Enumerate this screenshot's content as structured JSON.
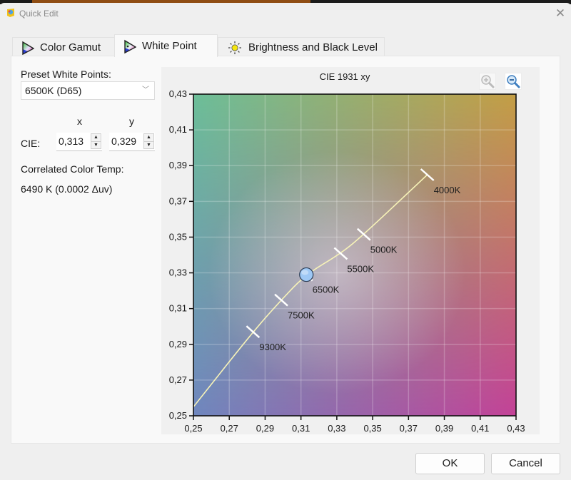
{
  "window": {
    "title": "Quick Edit",
    "close_icon": "close-icon"
  },
  "tabs": [
    {
      "label": "Color Gamut",
      "icon": "color-gamut-triangle-icon",
      "active": false
    },
    {
      "label": "White Point",
      "icon": "white-point-triangle-icon",
      "active": true
    },
    {
      "label": "Brightness and Black Level",
      "icon": "sun-icon",
      "active": false
    }
  ],
  "left": {
    "preset_label": "Preset White Points:",
    "preset_value": "6500K (D65)",
    "x_header": "x",
    "y_header": "y",
    "cie_label": "CIE:",
    "cie_x": "0,313",
    "cie_y": "0,329",
    "cct_label": "Correlated Color Temp:",
    "cct_value": "6490 K (0.0002 Δuv)"
  },
  "toolbar": {
    "zoom_in_icon": "zoom-in-icon",
    "zoom_out_icon": "zoom-out-icon"
  },
  "buttons": {
    "ok": "OK",
    "cancel": "Cancel"
  },
  "colors": {
    "corner_top_left": "#6cc396",
    "corner_top_right": "#c4a63e",
    "corner_bottom_left": "#6f83c0",
    "corner_bottom_right": "#c33c9c",
    "locus_line": "#f7f3b8",
    "point_fill": "#9ec8f5"
  },
  "chart_data": {
    "type": "scatter",
    "title": "CIE 1931 xy",
    "xlabel": "",
    "ylabel": "",
    "xlim": [
      0.25,
      0.43
    ],
    "ylim": [
      0.25,
      0.43
    ],
    "grid": true,
    "x_ticks": [
      "0,25",
      "0,27",
      "0,29",
      "0,31",
      "0,33",
      "0,35",
      "0,37",
      "0,39",
      "0,41",
      "0,43"
    ],
    "y_ticks": [
      "0,25",
      "0,27",
      "0,29",
      "0,31",
      "0,33",
      "0,35",
      "0,37",
      "0,39",
      "0,41",
      "0,43"
    ],
    "planckian_locus": [
      {
        "x": 0.25,
        "y": 0.255
      },
      {
        "x": 0.2832,
        "y": 0.297
      },
      {
        "x": 0.299,
        "y": 0.3148
      },
      {
        "x": 0.3128,
        "y": 0.3292
      },
      {
        "x": 0.3322,
        "y": 0.3408
      },
      {
        "x": 0.3451,
        "y": 0.3515
      },
      {
        "x": 0.3805,
        "y": 0.3849
      }
    ],
    "cct_marks": [
      {
        "label": "9300K",
        "x": 0.2832,
        "y": 0.297,
        "tick": true
      },
      {
        "label": "7500K",
        "x": 0.299,
        "y": 0.3148,
        "tick": true
      },
      {
        "label": "6500K",
        "x": 0.3128,
        "y": 0.3292,
        "tick": false
      },
      {
        "label": "5500K",
        "x": 0.3322,
        "y": 0.3408,
        "tick": true
      },
      {
        "label": "5000K",
        "x": 0.3451,
        "y": 0.3515,
        "tick": true
      },
      {
        "label": "4000K",
        "x": 0.3805,
        "y": 0.3849,
        "tick": true
      }
    ],
    "selected_point": {
      "x": 0.313,
      "y": 0.329
    }
  }
}
